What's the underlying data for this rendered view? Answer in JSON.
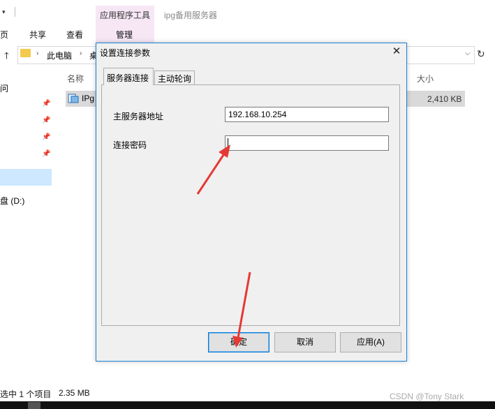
{
  "explorer": {
    "quick_access_arrow": "▾",
    "context_tab_label": "应用程序工具",
    "window_title": "ipg备用服务器",
    "ribbon_tabs": [
      "页",
      "共享",
      "查看",
      "管理"
    ],
    "path": [
      "此电脑",
      "桌"
    ],
    "nav": {
      "item_quick": "问",
      "item_drive": "盘 (D:)"
    },
    "columns": {
      "name": "名称",
      "size": "大小"
    },
    "file": {
      "name": "IPg",
      "size": "2,410 KB"
    },
    "status_left": "选中 1 个项目",
    "status_size": "2.35 MB",
    "watermark": "CSDN @Tony Stark"
  },
  "dialog": {
    "title": "设置连接参数",
    "close_glyph": "✕",
    "tabs": [
      {
        "label": "服务器连接",
        "active": true
      },
      {
        "label": "主动轮询",
        "active": false
      }
    ],
    "server_label": "主服务器地址",
    "server_value": "192.168.10.254",
    "password_label": "连接密码",
    "password_value": "",
    "buttons": {
      "ok": "确定",
      "cancel": "取消",
      "apply": "应用(A)"
    }
  },
  "icons": {
    "up": "up-arrow-icon",
    "refresh": "refresh-icon",
    "pin": "pin-icon",
    "folder": "folder-icon",
    "app": "app-icon"
  },
  "colors": {
    "context_tab": "#f7e7f5",
    "selection": "#cde8ff",
    "annotation_arrow": "#e53935",
    "dialog_border": "#1883d7"
  }
}
